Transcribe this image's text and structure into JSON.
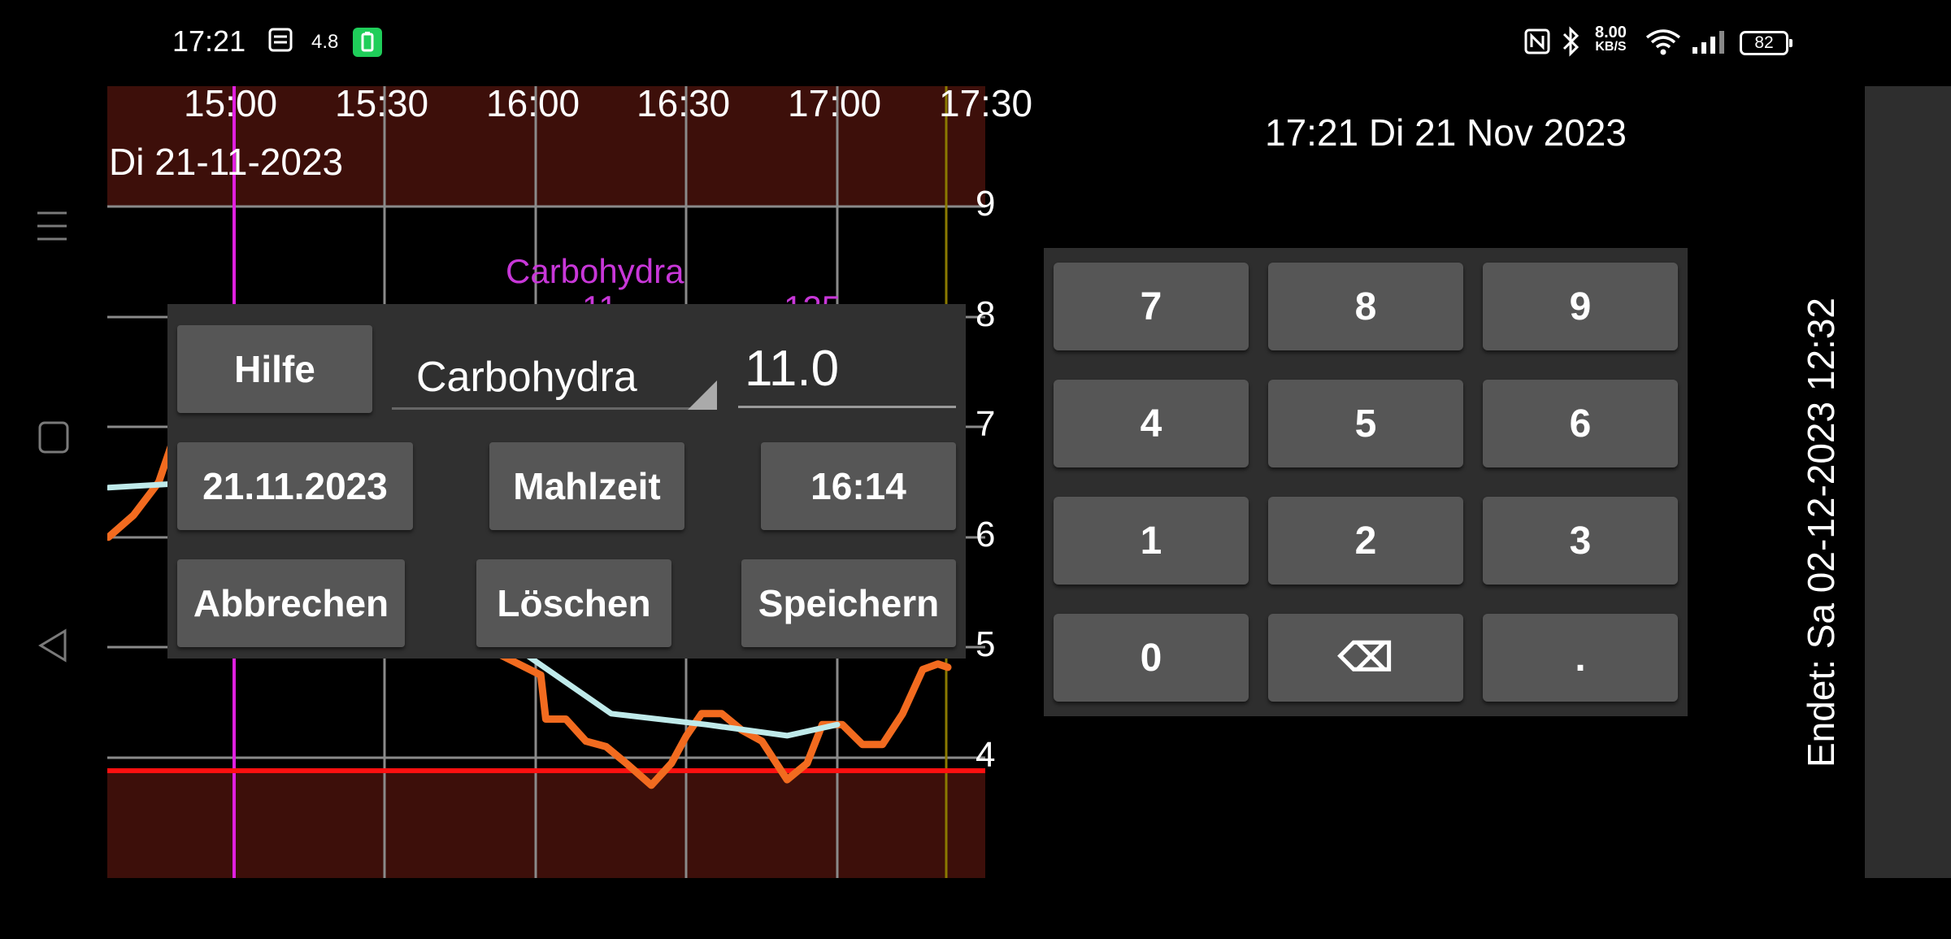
{
  "status_bar": {
    "time": "17:21",
    "misc_value": "4.8",
    "net_speed_value": "8.00",
    "net_speed_unit": "KB/S",
    "battery_level": "82"
  },
  "chart": {
    "date_label": "Di 21-11-2023",
    "time_ticks": [
      "15:00",
      "15:30",
      "16:00",
      "16:30",
      "17:00",
      "17:30"
    ],
    "y_ticks": [
      "9",
      "8",
      "7",
      "6",
      "5",
      "4"
    ],
    "annotation_label": "Carbohydra",
    "annotation_value_1": "11",
    "annotation_value_2": "125"
  },
  "chart_data": {
    "type": "line",
    "x_start": "14:35",
    "x_end": "17:30",
    "ylim": [
      2.0,
      9.8
    ],
    "low_threshold": 3.9,
    "series": [
      {
        "color": "#f26b1f",
        "values": [
          [
            "14:35",
            6.0
          ],
          [
            "14:40",
            6.2
          ],
          [
            "14:45",
            6.5
          ],
          [
            "14:48",
            6.9
          ],
          [
            "14:52",
            7.0
          ],
          [
            "15:50",
            5.0
          ],
          [
            "16:01",
            4.75
          ],
          [
            "16:02",
            4.35
          ],
          [
            "16:06",
            4.35
          ],
          [
            "16:10",
            4.15
          ],
          [
            "16:14",
            4.1
          ],
          [
            "16:18",
            3.95
          ],
          [
            "16:23",
            3.75
          ],
          [
            "16:27",
            3.95
          ],
          [
            "16:30",
            4.2
          ],
          [
            "16:33",
            4.4
          ],
          [
            "16:37",
            4.4
          ],
          [
            "16:41",
            4.25
          ],
          [
            "16:45",
            4.15
          ],
          [
            "16:50",
            3.8
          ],
          [
            "16:54",
            3.95
          ],
          [
            "16:57",
            4.3
          ],
          [
            "17:01",
            4.3
          ],
          [
            "17:05",
            4.12
          ],
          [
            "17:09",
            4.12
          ],
          [
            "17:13",
            4.4
          ],
          [
            "17:17",
            4.8
          ],
          [
            "17:20",
            4.85
          ],
          [
            "17:22",
            4.82
          ]
        ]
      },
      {
        "color": "#bfeaea",
        "values": [
          [
            "14:35",
            6.45
          ],
          [
            "14:54",
            6.5
          ],
          [
            "14:56",
            6.55
          ],
          [
            "15:56",
            5.0
          ],
          [
            "16:15",
            4.4
          ],
          [
            "16:34",
            4.3
          ],
          [
            "16:50",
            4.2
          ],
          [
            "17:00",
            4.3
          ]
        ]
      }
    ],
    "marker_time": "15:00",
    "now_time": "17:21"
  },
  "dialog": {
    "help_label": "Hilfe",
    "type_value": "Carbohydra",
    "amount_value": "11.0",
    "date_label": "21.11.2023",
    "meal_label": "Mahlzeit",
    "time_label": "16:14",
    "cancel_label": "Abbrechen",
    "delete_label": "Löschen",
    "save_label": "Speichern"
  },
  "right_panel": {
    "datetime": "17:21 Di 21 Nov 2023",
    "ends_label": "Endet: Sa 02-12-2023 12:32"
  },
  "keypad": {
    "keys": [
      "7",
      "8",
      "9",
      "4",
      "5",
      "6",
      "1",
      "2",
      "3",
      "0",
      "⌫",
      "."
    ]
  },
  "nav": {
    "menu_icon": "hamburger-menu-icon",
    "home_icon": "square-home-icon",
    "back_icon": "triangle-back-icon"
  }
}
